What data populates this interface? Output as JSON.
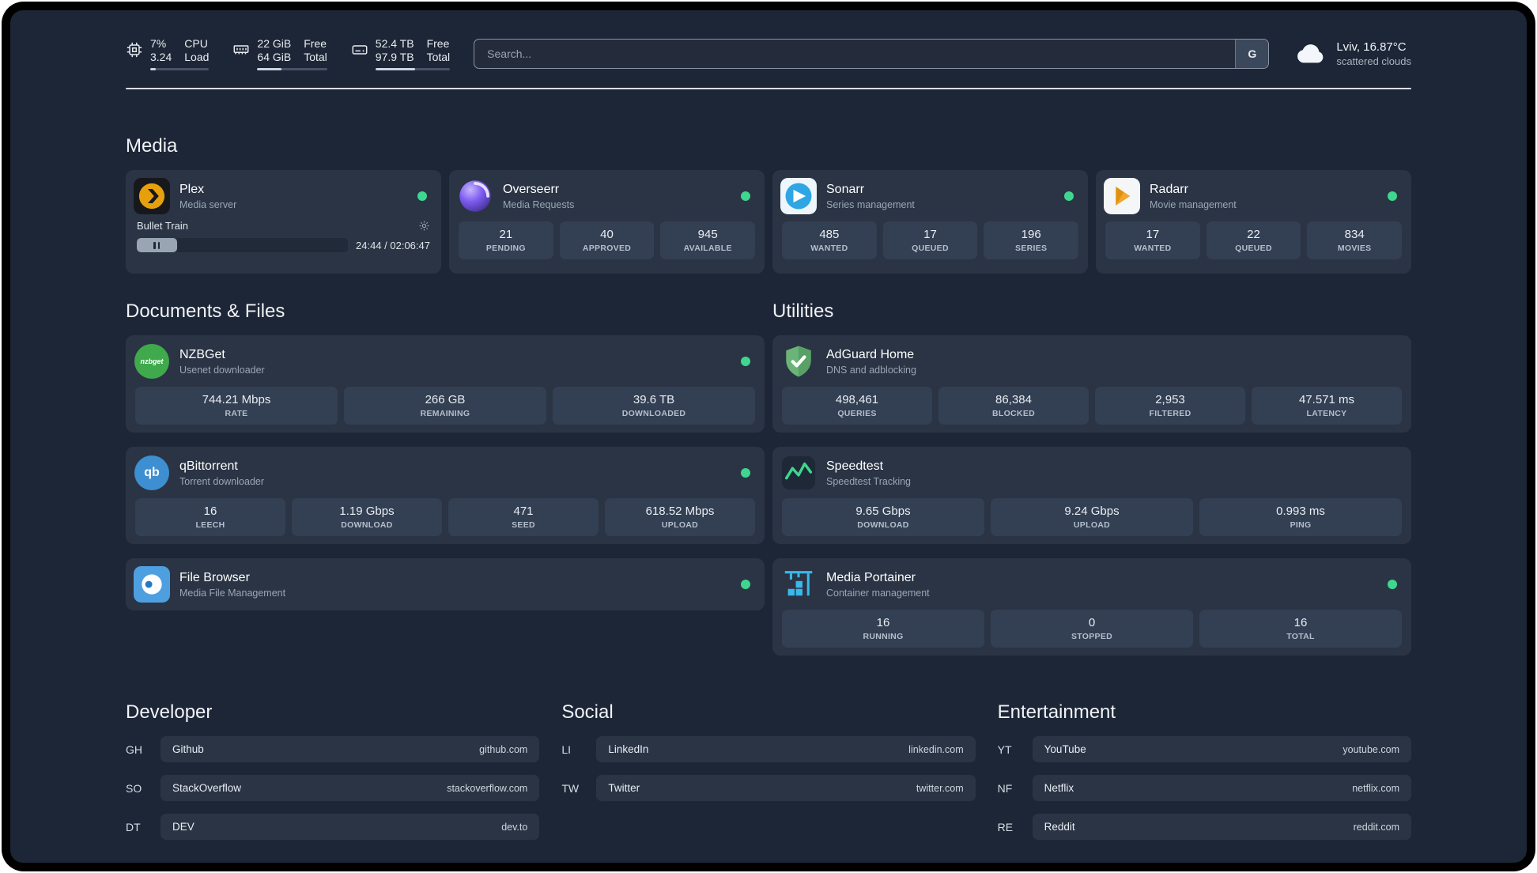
{
  "topbar": {
    "cpu": {
      "value_top": "7%",
      "value_bottom": "3.24",
      "label_top": "CPU",
      "label_bottom": "Load",
      "bar_percent": 10
    },
    "memory": {
      "value_top": "22 GiB",
      "value_bottom": "64 GiB",
      "label_top": "Free",
      "label_bottom": "Total",
      "bar_percent": 35
    },
    "disk": {
      "value_top": "52.4 TB",
      "value_bottom": "97.9 TB",
      "label_top": "Free",
      "label_bottom": "Total",
      "bar_percent": 53
    },
    "search": {
      "placeholder": "Search...",
      "button_label": "G"
    },
    "weather": {
      "location": "Lviv, 16.87°C",
      "condition": "scattered clouds"
    }
  },
  "sections": {
    "media": "Media",
    "documents": "Documents & Files",
    "utilities": "Utilities",
    "developer": "Developer",
    "social": "Social",
    "entertainment": "Entertainment"
  },
  "services": {
    "plex": {
      "title": "Plex",
      "subtitle": "Media server",
      "now_playing": "Bullet Train",
      "time": "24:44 / 02:06:47",
      "progress_percent": 19
    },
    "overseerr": {
      "title": "Overseerr",
      "subtitle": "Media Requests",
      "stats": [
        {
          "value": "21",
          "label": "PENDING"
        },
        {
          "value": "40",
          "label": "APPROVED"
        },
        {
          "value": "945",
          "label": "AVAILABLE"
        }
      ]
    },
    "sonarr": {
      "title": "Sonarr",
      "subtitle": "Series management",
      "stats": [
        {
          "value": "485",
          "label": "WANTED"
        },
        {
          "value": "17",
          "label": "QUEUED"
        },
        {
          "value": "196",
          "label": "SERIES"
        }
      ]
    },
    "radarr": {
      "title": "Radarr",
      "subtitle": "Movie management",
      "stats": [
        {
          "value": "17",
          "label": "WANTED"
        },
        {
          "value": "22",
          "label": "QUEUED"
        },
        {
          "value": "834",
          "label": "MOVIES"
        }
      ]
    },
    "nzbget": {
      "title": "NZBGet",
      "subtitle": "Usenet downloader",
      "icon_text": "nzbget",
      "stats": [
        {
          "value": "744.21 Mbps",
          "label": "RATE"
        },
        {
          "value": "266 GB",
          "label": "REMAINING"
        },
        {
          "value": "39.6 TB",
          "label": "DOWNLOADED"
        }
      ]
    },
    "qbittorrent": {
      "title": "qBittorrent",
      "subtitle": "Torrent downloader",
      "icon_text": "qb",
      "stats": [
        {
          "value": "16",
          "label": "LEECH"
        },
        {
          "value": "1.19 Gbps",
          "label": "DOWNLOAD"
        },
        {
          "value": "471",
          "label": "SEED"
        },
        {
          "value": "618.52 Mbps",
          "label": "UPLOAD"
        }
      ]
    },
    "filebrowser": {
      "title": "File Browser",
      "subtitle": "Media File Management"
    },
    "adguard": {
      "title": "AdGuard Home",
      "subtitle": "DNS and adblocking",
      "stats": [
        {
          "value": "498,461",
          "label": "QUERIES"
        },
        {
          "value": "86,384",
          "label": "BLOCKED"
        },
        {
          "value": "2,953",
          "label": "FILTERED"
        },
        {
          "value": "47.571 ms",
          "label": "LATENCY"
        }
      ]
    },
    "speedtest": {
      "title": "Speedtest",
      "subtitle": "Speedtest Tracking",
      "stats": [
        {
          "value": "9.65 Gbps",
          "label": "DOWNLOAD"
        },
        {
          "value": "9.24 Gbps",
          "label": "UPLOAD"
        },
        {
          "value": "0.993 ms",
          "label": "PING"
        }
      ]
    },
    "portainer": {
      "title": "Media Portainer",
      "subtitle": "Container management",
      "stats": [
        {
          "value": "16",
          "label": "RUNNING"
        },
        {
          "value": "0",
          "label": "STOPPED"
        },
        {
          "value": "16",
          "label": "TOTAL"
        }
      ]
    }
  },
  "bookmarks": {
    "developer": [
      {
        "abbr": "GH",
        "name": "Github",
        "domain": "github.com"
      },
      {
        "abbr": "SO",
        "name": "StackOverflow",
        "domain": "stackoverflow.com"
      },
      {
        "abbr": "DT",
        "name": "DEV",
        "domain": "dev.to"
      }
    ],
    "social": [
      {
        "abbr": "LI",
        "name": "LinkedIn",
        "domain": "linkedin.com"
      },
      {
        "abbr": "TW",
        "name": "Twitter",
        "domain": "twitter.com"
      }
    ],
    "entertainment": [
      {
        "abbr": "YT",
        "name": "YouTube",
        "domain": "youtube.com"
      },
      {
        "abbr": "NF",
        "name": "Netflix",
        "domain": "netflix.com"
      },
      {
        "abbr": "RE",
        "name": "Reddit",
        "domain": "reddit.com"
      }
    ]
  },
  "colors": {
    "status_online": "#3fd68f",
    "card_bg": "#2a3444",
    "page_bg": "#1d2636"
  }
}
